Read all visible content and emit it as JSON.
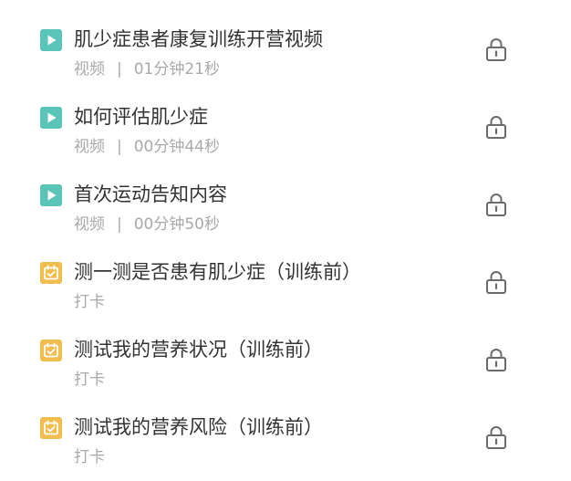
{
  "colors": {
    "video_icon": "#5bc4b9",
    "checkin_icon": "#f0bd4e",
    "title": "#333333",
    "meta": "#a9a9a9",
    "lock": "#6b6b6b"
  },
  "lessons": [
    {
      "icon": "play-video-icon",
      "title": "肌少症患者康复训练开营视频",
      "type": "视频",
      "separator": "|",
      "duration": "01分钟21秒",
      "locked": true
    },
    {
      "icon": "play-video-icon",
      "title": "如何评估肌少症",
      "type": "视频",
      "separator": "|",
      "duration": "00分钟44秒",
      "locked": true
    },
    {
      "icon": "play-video-icon",
      "title": "首次运动告知内容",
      "type": "视频",
      "separator": "|",
      "duration": "00分钟50秒",
      "locked": true
    },
    {
      "icon": "calendar-checkin-icon",
      "title": "测一测是否患有肌少症（训练前）",
      "type": "打卡",
      "locked": true
    },
    {
      "icon": "calendar-checkin-icon",
      "title": "测试我的营养状况（训练前）",
      "type": "打卡",
      "locked": true
    },
    {
      "icon": "calendar-checkin-icon",
      "title": "测试我的营养风险（训练前）",
      "type": "打卡",
      "locked": true
    }
  ]
}
